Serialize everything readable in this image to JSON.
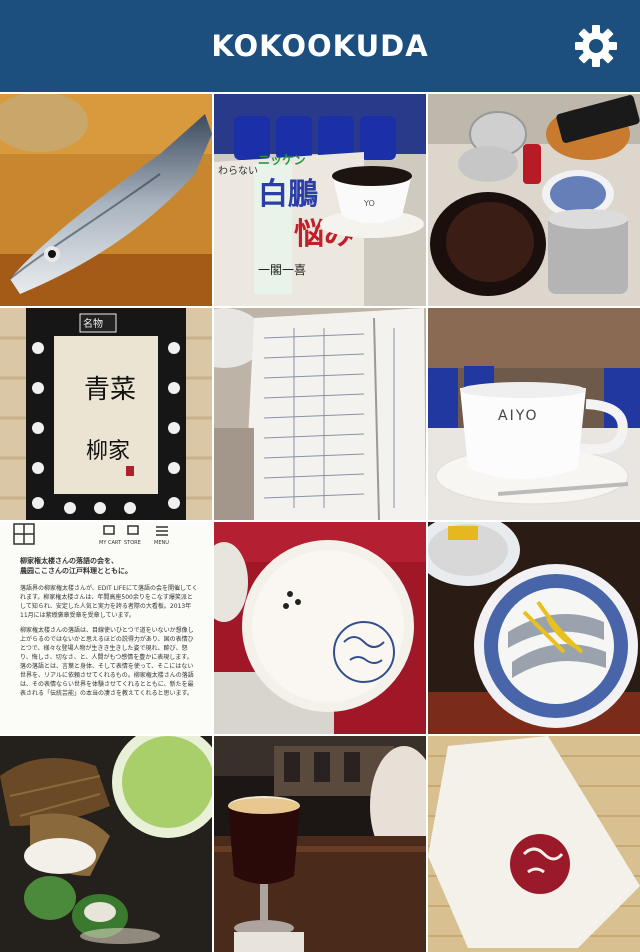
{
  "app": {
    "title": "KOKOOKUDA",
    "header_color": "#1d4f7e",
    "settings_icon": "gear-icon"
  },
  "photos": [
    {
      "name": "photo-fish"
    },
    {
      "name": "photo-newspaper-coffee",
      "texts": {
        "headline": "白鵬",
        "headline2": "悩み",
        "cup": "YO",
        "label": "一閣一喜",
        "small": "ニッケン",
        "small2": "わらない"
      }
    },
    {
      "name": "photo-teapots"
    },
    {
      "name": "photo-noren-calligraphy",
      "texts": {
        "main": "青菜",
        "sub": "柳家",
        "stamp": "名物"
      }
    },
    {
      "name": "photo-notebook-table"
    },
    {
      "name": "photo-aiyo-coffee",
      "texts": {
        "cup": "AIYO"
      }
    },
    {
      "name": "photo-web-article",
      "texts": {
        "nav_cart": "MY CART",
        "nav_store": "STORE",
        "nav_menu": "MENU",
        "heading": "柳家権太楼さんの落語の会を、\n農园ここさんの江戸料理とともに。",
        "p1": "落語界の柳家権太楼さんが、EDIT LIFEにて落語の会を開催してくれます。柳家権太楼さんは、年間高座500余りをこなす爆笑派として知られ、安定した人気と実力を誇る者際の大看板。2013年11月には紫綬褒章受章を受章しています。",
        "p2": "柳家権太楼さんの落語は、目線使いひとつで道をいないか想像し上がらるのではないかと思えるほどの説得力があり、国の表情ひとつで、様々な登場人物が生きき生きした姿で現れ、酔び、怒り、悔しさ、切なさ、と、人間がもつ感情を豊かに表現します。落の落語とは、言葉と身体、そして表情を使って、そこにはない世界を、リアルに依頼させてくれるもの。柳家権太楼さんの落語は、その表情ならい世界を体験させてくれるとともに、新たを最表される「伝統芸能」の本当の凄さを教えてくれると思います。"
      }
    },
    {
      "name": "photo-teacup-lid"
    },
    {
      "name": "photo-sushi-bowl"
    },
    {
      "name": "photo-wagashi-tea"
    },
    {
      "name": "photo-cafe-drink"
    },
    {
      "name": "photo-paper-bag"
    }
  ]
}
